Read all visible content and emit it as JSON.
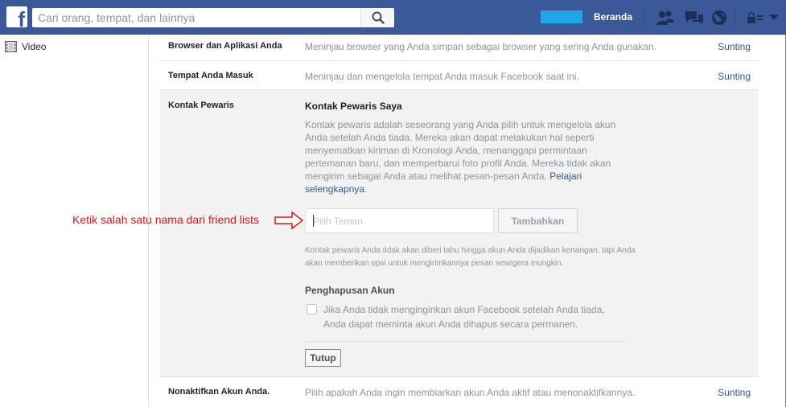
{
  "topbar": {
    "logo": "f",
    "search_placeholder": "Cari orang, tempat, dan lainnya",
    "home_label": "Beranda",
    "icons": [
      "friends-icon",
      "messages-icon",
      "globe-icon",
      "privacy-icon",
      "dropdown-arrow-icon"
    ]
  },
  "left_nav": {
    "items": [
      {
        "label": "Video",
        "icon": "film-icon"
      }
    ]
  },
  "rows": [
    {
      "title": "Browser dan Aplikasi Anda",
      "desc": "Meninjau browser yang Anda simpan sebagai browser yang sering Anda gunakan.",
      "edit": "Sunting"
    },
    {
      "title": "Tempat Anda Masuk",
      "desc": "Meninjau dan mengelola tempat Anda masuk Facebook saat ini.",
      "edit": "Sunting"
    },
    {
      "title": "Nonaktifkan Akun Anda.",
      "desc": "Pilih apakah Anda ingin membiarkan akun Anda aktif atau menonaktifkannya.",
      "edit": "Sunting"
    }
  ],
  "legacy": {
    "title": "Kontak Pewaris",
    "heading": "Kontak Pewaris Saya",
    "paragraph": "Kontak pewaris adalah seseorang yang Anda pilih untuk mengelola akun Anda setelah Anda tiada. Mereka akan dapat melakukan hal seperti menyematkan kiriman di Kronologi Anda, menanggapi permintaan pertemanan baru, dan memperbarui foto profil Anda. Mereka tidak akan mengirim sebagai Anda atau melihat pesan-pesan Anda. ",
    "learn_more": "Pelajari selengkapnya",
    "period": ".",
    "input_placeholder": "Pilih Teman",
    "add_button": "Tambahkan",
    "note": "Kontak pewaris Anda tidak akan diberi tahu hingga akun Anda dijadikan kenangan, tapi Anda akan memberikan opsi untuk mengirimkannya pesan sesegera mungkin.",
    "delete_heading": "Penghapusan Akun",
    "delete_checkbox_label": "Jika Anda tidak menginginkan akun Facebook setelah Anda tiada, Anda dapat meminta akun Anda dihapus secara permanen.",
    "close_button": "Tutup"
  },
  "annotation": {
    "text": "Ketik salah satu nama dari friend lists"
  },
  "colors": {
    "brand": "#3b5998",
    "link": "#365899",
    "annotation": "#e0141e",
    "avatar_redact": "#1ea7e7"
  }
}
